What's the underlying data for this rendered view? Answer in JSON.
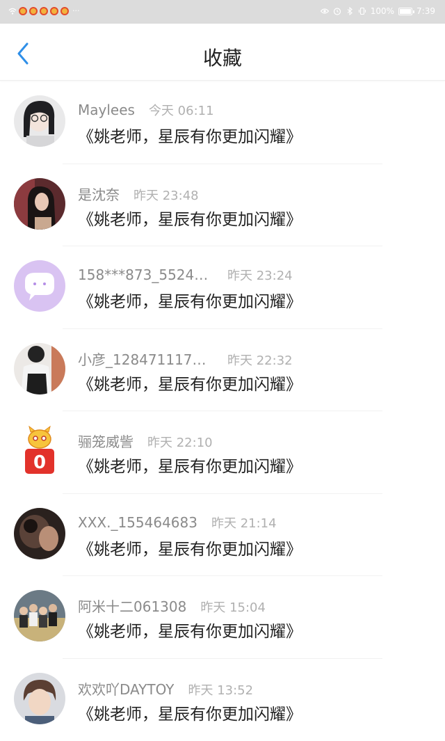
{
  "status_bar": {
    "battery_text": "100%",
    "time": "7:39",
    "more": "···"
  },
  "header": {
    "title": "收藏"
  },
  "favorites": [
    {
      "name": "Maylees",
      "time": "今天 06:11",
      "message": "《姚老师，星辰有你更加闪耀》"
    },
    {
      "name": "是沈奈",
      "time": "昨天 23:48",
      "message": "《姚老师，星辰有你更加闪耀》"
    },
    {
      "name": "158***873_55240...",
      "time": "昨天 23:24",
      "message": "《姚老师，星辰有你更加闪耀》"
    },
    {
      "name": "小彦_1284711177...",
      "time": "昨天 22:32",
      "message": "《姚老师，星辰有你更加闪耀》"
    },
    {
      "name": "骊笼威訾",
      "time": "昨天 22:10",
      "message": "《姚老师，星辰有你更加闪耀》"
    },
    {
      "name": "XXX._155464683",
      "time": "昨天 21:14",
      "message": "《姚老师，星辰有你更加闪耀》"
    },
    {
      "name": "阿米十二061308",
      "time": "昨天 15:04",
      "message": "《姚老师，星辰有你更加闪耀》"
    },
    {
      "name": "欢欢吖DAYTOY",
      "time": "昨天 13:52",
      "message": "《姚老师，星辰有你更加闪耀》"
    }
  ],
  "avatar_badge": "0",
  "colors": {
    "accent": "#2f8fe8",
    "status_bar_bg": "#dcdcdc",
    "name_gray": "#8a8a8a",
    "time_gray": "#b0b0b0",
    "message_text": "#222222",
    "avatar_bubble_bg": "#d9c3f2"
  }
}
